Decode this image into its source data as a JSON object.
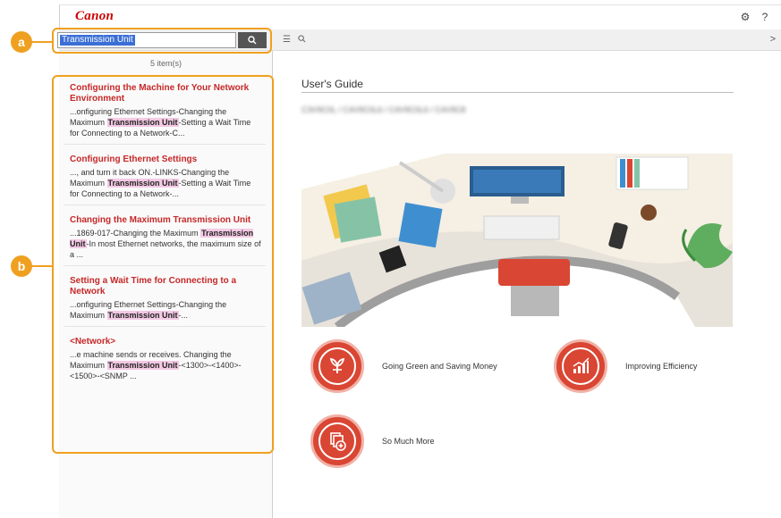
{
  "header": {
    "brand": "Canon",
    "settings_icon": "gear-icon",
    "help_label": "?"
  },
  "search": {
    "query": "Transmission Unit",
    "button_icon": "search-icon",
    "results_count": "5 item(s)"
  },
  "toolbar": {
    "toc_icon": "list-icon",
    "search_icon": "search-icon",
    "chevron": ">"
  },
  "callouts": {
    "a": "a",
    "b": "b"
  },
  "results": [
    {
      "title": "Configuring the Machine for Your Network Environment",
      "pre": "...onfiguring Ethernet Settings-Changing the Maximum ",
      "hl": "Transmission Unit",
      "post": "-Setting a Wait Time for Connecting to a Network-C..."
    },
    {
      "title": "Configuring Ethernet Settings",
      "pre": "..., and turn it back ON.-LINKS-Changing the Maximum ",
      "hl": "Transmission Unit",
      "post": "-Setting a Wait Time for Connecting to a Network-..."
    },
    {
      "title": "Changing the Maximum Transmission Unit",
      "pre": "...1869-017-Changing the Maximum ",
      "hl": "Transmission Unit",
      "post": "-In most Ethernet networks, the maximum size of a ..."
    },
    {
      "title": "Setting a Wait Time for Connecting to a Network",
      "pre": "...onfiguring Ethernet Settings-Changing the Maximum ",
      "hl": "Transmission Unit",
      "post": "-..."
    },
    {
      "title": "<Network>",
      "pre": "...e machine sends or receives. Changing the Maximum ",
      "hl": "Transmission Unit",
      "post": "-<1300>-<1400>-<1500>-<SNMP ..."
    }
  ],
  "main": {
    "title": "User's Guide",
    "blurred_text": "C3V9C0L / C4V9C0L6 / C4V9C0L6 / C4V9C8"
  },
  "features": [
    {
      "label": "Going Green and Saving Money",
      "icon": "leaf-icon"
    },
    {
      "label": "Improving Efficiency",
      "icon": "bar-chart-icon"
    },
    {
      "label": "So Much More",
      "icon": "documents-plus-icon"
    }
  ],
  "colors": {
    "brand_red": "#cc0000",
    "accent_red": "#d94633",
    "callout_orange": "#f0a020",
    "highlight_pink": "#f3c9e4",
    "selection_blue": "#3b6fd6"
  }
}
